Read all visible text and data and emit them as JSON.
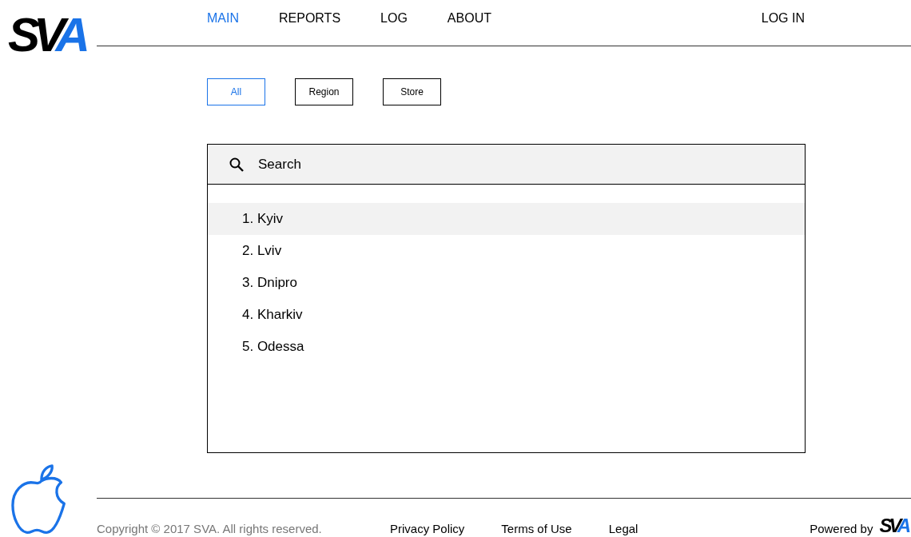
{
  "logo": {
    "text": "SVA"
  },
  "nav": [
    {
      "label": "MAIN",
      "selected": true
    },
    {
      "label": "REPORTS",
      "selected": false
    },
    {
      "label": "LOG",
      "selected": false
    },
    {
      "label": "ABOUT",
      "selected": false
    }
  ],
  "login": "LOG IN",
  "filters": [
    {
      "label": "All",
      "selected": true
    },
    {
      "label": "Region",
      "selected": false
    },
    {
      "label": "Store",
      "selected": false
    }
  ],
  "search": {
    "placeholder": "Search"
  },
  "list": [
    {
      "label": "1. Kyiv",
      "selected": true
    },
    {
      "label": "2. Lviv",
      "selected": false
    },
    {
      "label": "3. Dnipro",
      "selected": false
    },
    {
      "label": "4. Kharkiv",
      "selected": false
    },
    {
      "label": "5. Odessa",
      "selected": false
    }
  ],
  "footer": {
    "copyright": "Copyright © 2017 SVA. All rights reserved.",
    "links": [
      "Privacy Policy",
      "Terms of Use",
      "Legal"
    ],
    "powered_by": "Powered by",
    "logo": "SVA"
  }
}
